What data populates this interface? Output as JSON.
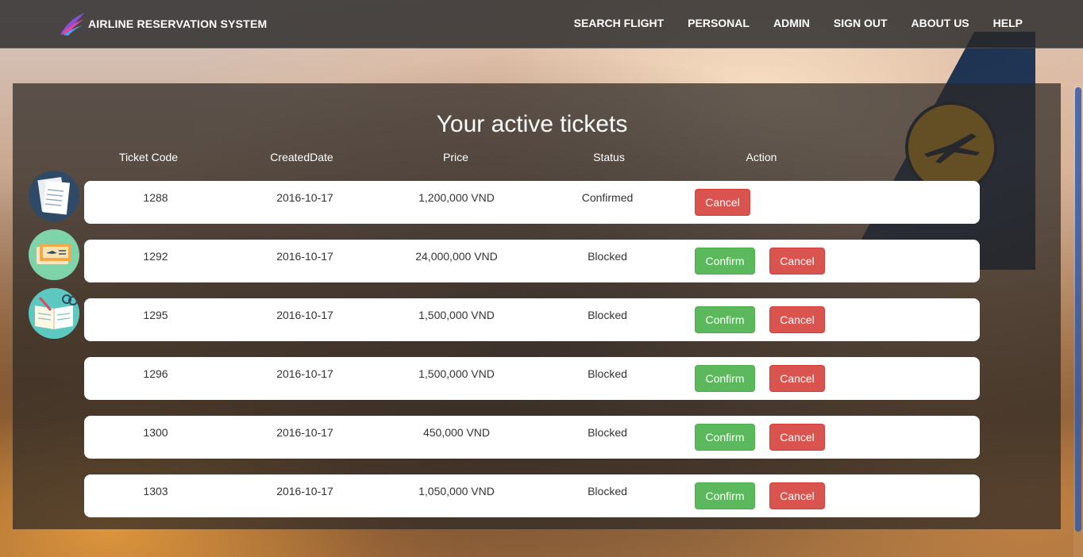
{
  "brand": {
    "title": "AIRLINE RESERVATION SYSTEM",
    "icon": "plane-wing-logo-icon"
  },
  "nav": [
    {
      "label": "SEARCH FLIGHT"
    },
    {
      "label": "PERSONAL"
    },
    {
      "label": "ADMIN"
    },
    {
      "label": "SIGN OUT"
    },
    {
      "label": "ABOUT US"
    },
    {
      "label": "HELP"
    }
  ],
  "page": {
    "title": "Your active tickets"
  },
  "table": {
    "headers": [
      "Ticket Code",
      "CreatedDate",
      "Price",
      "Status",
      "Action"
    ],
    "rows": [
      {
        "code": "1288",
        "date": "2016-10-17",
        "price": "1,200,000 VND",
        "status": "Confirmed",
        "cancel": "Cancel"
      },
      {
        "code": "1292",
        "date": "2016-10-17",
        "price": "24,000,000 VND",
        "status": "Blocked",
        "confirm": "Confirm",
        "cancel": "Cancel"
      },
      {
        "code": "1295",
        "date": "2016-10-17",
        "price": "1,500,000 VND",
        "status": "Blocked",
        "confirm": "Confirm",
        "cancel": "Cancel"
      },
      {
        "code": "1296",
        "date": "2016-10-17",
        "price": "1,500,000 VND",
        "status": "Blocked",
        "confirm": "Confirm",
        "cancel": "Cancel"
      },
      {
        "code": "1300",
        "date": "2016-10-17",
        "price": "450,000 VND",
        "status": "Blocked",
        "confirm": "Confirm",
        "cancel": "Cancel"
      },
      {
        "code": "1303",
        "date": "2016-10-17",
        "price": "1,050,000 VND",
        "status": "Blocked",
        "confirm": "Confirm",
        "cancel": "Cancel"
      }
    ]
  },
  "side_icons": [
    "documents-icon",
    "ticket-icon",
    "open-book-icon"
  ],
  "colors": {
    "confirm": "#5cb85c",
    "cancel": "#d9534f",
    "navbar": "#282828"
  }
}
